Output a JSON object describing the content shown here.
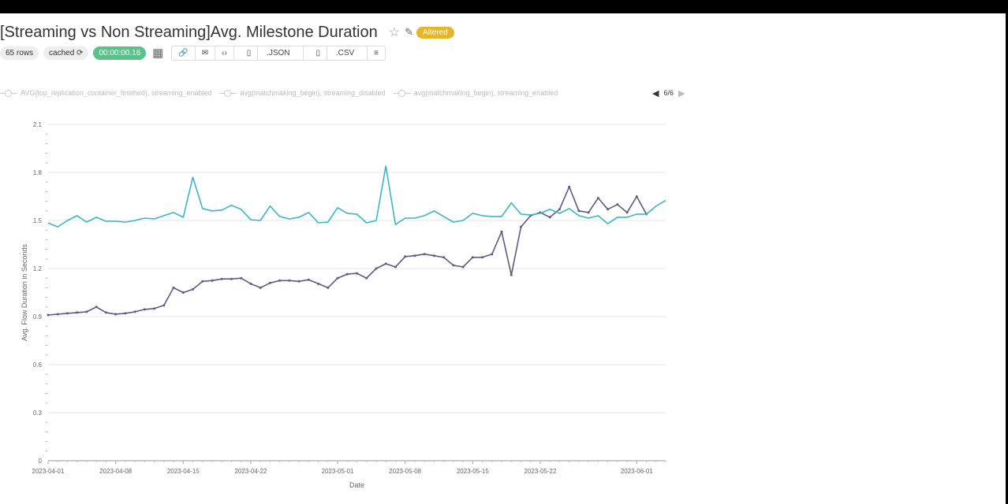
{
  "header": {
    "title": "[Streaming vs Non Streaming]Avg. Milestone Duration",
    "altered_label": "Altered",
    "star_icon": "star-icon",
    "edit_icon": "edit-icon"
  },
  "meta": {
    "rows": "65 rows",
    "cached": "cached",
    "timer": "00:00:00.16",
    "json_label": ".JSON",
    "csv_label": ".CSV"
  },
  "legend": {
    "items": [
      "AVG(top_replication_container_finished), streaming_enabled",
      "avg(matchmaking_begin), streaming_disabled",
      "avg(matchmaking_begin), streaming_enabled"
    ],
    "page": "6/6"
  },
  "colors": {
    "streaming_disabled": "#5c5c81",
    "streaming_enabled": "#3eb4c4",
    "timer_green": "#5ac189",
    "altered_yellow": "#e6b52a"
  },
  "chart_data": {
    "type": "line",
    "xlabel": "Date",
    "ylabel": "Avg. Flow Duration in Seconds",
    "ylim": [
      0,
      2.1
    ],
    "yticks": [
      "0",
      "0.3",
      "0.6",
      "0.9",
      "1.2",
      "1.5",
      "1.8",
      "2.1"
    ],
    "xticks": [
      "2023-04-01",
      "2023-04-08",
      "2023-04-15",
      "2023-04-22",
      "2023-05-01",
      "2023-05-08",
      "2023-05-15",
      "2023-05-22",
      "2023-06-01"
    ],
    "x": [
      "2023-04-01",
      "2023-04-02",
      "2023-04-03",
      "2023-04-04",
      "2023-04-05",
      "2023-04-06",
      "2023-04-07",
      "2023-04-08",
      "2023-04-09",
      "2023-04-10",
      "2023-04-11",
      "2023-04-12",
      "2023-04-13",
      "2023-04-14",
      "2023-04-15",
      "2023-04-16",
      "2023-04-17",
      "2023-04-18",
      "2023-04-19",
      "2023-04-20",
      "2023-04-21",
      "2023-04-22",
      "2023-04-23",
      "2023-04-24",
      "2023-04-25",
      "2023-04-26",
      "2023-04-27",
      "2023-04-28",
      "2023-04-29",
      "2023-04-30",
      "2023-05-01",
      "2023-05-02",
      "2023-05-03",
      "2023-05-04",
      "2023-05-05",
      "2023-05-06",
      "2023-05-07",
      "2023-05-08",
      "2023-05-09",
      "2023-05-10",
      "2023-05-11",
      "2023-05-12",
      "2023-05-13",
      "2023-05-14",
      "2023-05-15",
      "2023-05-16",
      "2023-05-17",
      "2023-05-18",
      "2023-05-19",
      "2023-05-20",
      "2023-05-21",
      "2023-05-22",
      "2023-05-23",
      "2023-05-24",
      "2023-05-25",
      "2023-05-26",
      "2023-05-27",
      "2023-05-28",
      "2023-05-29",
      "2023-05-30",
      "2023-05-31",
      "2023-06-01",
      "2023-06-02",
      "2023-06-03",
      "2023-06-04"
    ],
    "series": [
      {
        "name": "avg(matchmaking_begin), streaming_disabled",
        "values": [
          0.91,
          0.915,
          0.92,
          0.925,
          0.93,
          0.96,
          0.925,
          0.915,
          0.92,
          0.93,
          0.945,
          0.95,
          0.97,
          1.08,
          1.05,
          1.07,
          1.12,
          1.125,
          1.135,
          1.135,
          1.14,
          1.105,
          1.08,
          1.11,
          1.125,
          1.125,
          1.12,
          1.13,
          1.105,
          1.08,
          1.14,
          1.165,
          1.17,
          1.14,
          1.2,
          1.23,
          1.21,
          1.275,
          1.28,
          1.29,
          1.28,
          1.27,
          1.22,
          1.21,
          1.27,
          1.27,
          1.29,
          1.43,
          1.16,
          1.46,
          1.53,
          1.55,
          1.52,
          1.57,
          1.71,
          1.56,
          1.55,
          1.64,
          1.57,
          1.6,
          1.55,
          1.65,
          1.54,
          null,
          null
        ]
      },
      {
        "name": "avg(matchmaking_begin), streaming_enabled",
        "values": [
          1.485,
          1.46,
          1.5,
          1.53,
          1.49,
          1.52,
          1.495,
          1.495,
          1.49,
          1.5,
          1.515,
          1.51,
          1.53,
          1.55,
          1.52,
          1.77,
          1.575,
          1.56,
          1.565,
          1.595,
          1.57,
          1.505,
          1.5,
          1.59,
          1.525,
          1.51,
          1.52,
          1.55,
          1.485,
          1.49,
          1.58,
          1.545,
          1.54,
          1.485,
          1.5,
          1.84,
          1.475,
          1.515,
          1.515,
          1.53,
          1.56,
          1.525,
          1.49,
          1.5,
          1.545,
          1.53,
          1.525,
          1.525,
          1.61,
          1.54,
          1.535,
          1.545,
          1.57,
          1.545,
          1.575,
          1.53,
          1.515,
          1.53,
          1.48,
          1.52,
          1.52,
          1.54,
          1.54,
          1.59,
          1.625
        ]
      }
    ]
  }
}
